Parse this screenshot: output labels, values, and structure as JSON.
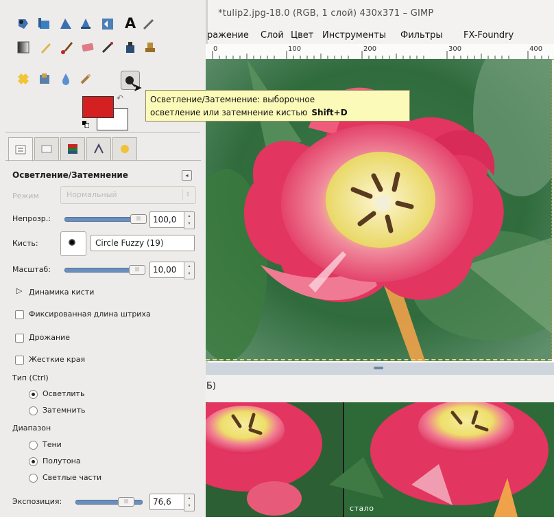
{
  "window": {
    "title": "*tulip2.jpg-18.0 (RGB, 1 слой) 430x371 – GIMP"
  },
  "menubar": {
    "items": [
      "ражение",
      "Слой",
      "Цвет",
      "Инструменты",
      "Фильтры",
      "FX-Foundry"
    ]
  },
  "ruler": {
    "marks": [
      "0",
      "100",
      "200",
      "300",
      "400"
    ]
  },
  "toolbox": {
    "tools": [
      "foreground-select-icon",
      "crop-icon",
      "paths-icon",
      "align-icon",
      "flip-icon",
      "text-icon",
      "color-picker-icon",
      "blend-icon",
      "pencil-icon",
      "paintbrush-icon",
      "eraser-icon",
      "airbrush-icon",
      "ink-icon",
      "clone-icon",
      "heal-icon",
      "perspective-clone-icon",
      "blur-sharpen-icon",
      "smudge-icon",
      "dodge-burn-icon"
    ],
    "active_tool": "dodge-burn-icon",
    "fg_color": "#d42020",
    "bg_color": "#ffffff"
  },
  "tooltip": {
    "line1": "Осветление/Затемнение: выборочное",
    "line2": "осветление или затемнение кистью",
    "shortcut": "Shift+D"
  },
  "tool_options": {
    "title": "Осветление/Затемнение",
    "mode_label": "Режим",
    "mode_value": "Нормальный",
    "opacity_label": "Непрозр.:",
    "opacity_value": "100,0",
    "opacity_fraction": 1.0,
    "brush_label": "Кисть:",
    "brush_name": "Circle Fuzzy (19)",
    "scale_label": "Масштаб:",
    "scale_value": "10,00",
    "dynamics_label": "Динамика кисти",
    "checkboxes": [
      {
        "label": "Фиксированная длина штриха",
        "checked": false
      },
      {
        "label": "Дрожание",
        "checked": false
      },
      {
        "label": "Жесткие края",
        "checked": false
      }
    ],
    "type_label": "Тип  (Ctrl)",
    "type_options": [
      {
        "label": "Осветлить",
        "selected": true
      },
      {
        "label": "Затемнить",
        "selected": false
      }
    ],
    "range_label": "Диапазон",
    "range_options": [
      {
        "label": "Тени",
        "selected": false
      },
      {
        "label": "Полутона",
        "selected": true
      },
      {
        "label": "Светлые части",
        "selected": false
      }
    ],
    "exposure_label": "Экспозиция:",
    "exposure_value": "76,6"
  },
  "preview": {
    "caption": "Б)",
    "after_label": "стало"
  },
  "colors": {
    "slider": "#6a8fbd",
    "tooltip_bg": "#fcfab9",
    "petal": "#e03a6a"
  }
}
